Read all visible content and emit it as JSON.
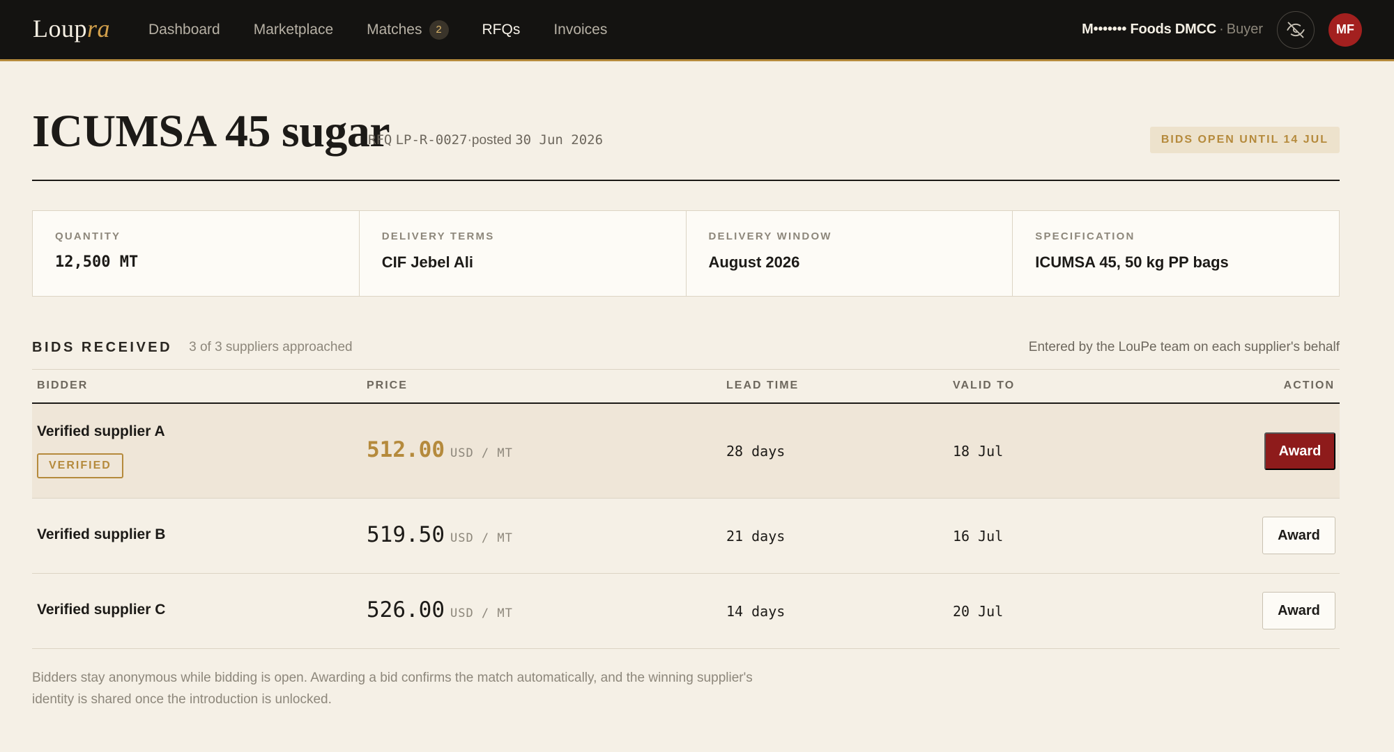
{
  "brand": {
    "name_prefix": "Loup",
    "name_accent": "ra"
  },
  "nav": {
    "links": [
      {
        "label": "Dashboard"
      },
      {
        "label": "Marketplace"
      },
      {
        "label": "Matches",
        "badge": "2"
      },
      {
        "label": "RFQs"
      },
      {
        "label": "Invoices"
      }
    ],
    "org_name": "M••••••• Foods DMCC",
    "separator": "·",
    "role": "Buyer",
    "avatar_initials": "MF"
  },
  "header": {
    "title": "ICUMSA 45 sugar",
    "rfq_prefix": "RFQ",
    "rfq_id": "LP-R-0027",
    "separator": "·",
    "posted_label": "posted",
    "posted_date": "30 Jun 2026",
    "status": "BIDS OPEN UNTIL 14 JUL"
  },
  "specs": [
    {
      "label": "QUANTITY",
      "value": "12,500 MT"
    },
    {
      "label": "DELIVERY TERMS",
      "value": "CIF Jebel Ali"
    },
    {
      "label": "DELIVERY WINDOW",
      "value": "August 2026"
    },
    {
      "label": "SPECIFICATION",
      "value": "ICUMSA 45, 50 kg PP bags"
    }
  ],
  "bids": {
    "title": "BIDS RECEIVED",
    "subtitle": "3 of 3 suppliers approached",
    "note": "Entered by the LouPe team on each supplier's behalf",
    "columns": [
      "BIDDER",
      "PRICE",
      "LEAD TIME",
      "VALID TO",
      "ACTION"
    ],
    "rows": [
      {
        "bidder": "Verified supplier A",
        "badge": "VERIFIED",
        "price": "512.00",
        "unit": "USD / MT",
        "lead": "28 days",
        "valid": "18 Jul",
        "action": "Award"
      },
      {
        "bidder": "Verified supplier B",
        "price": "519.50",
        "unit": "USD / MT",
        "lead": "21 days",
        "valid": "16 Jul",
        "action": "Award"
      },
      {
        "bidder": "Verified supplier C",
        "price": "526.00",
        "unit": "USD / MT",
        "lead": "14 days",
        "valid": "20 Jul",
        "action": "Award"
      }
    ],
    "footnote": "Bidders stay anonymous while bidding is open. Awarding a bid confirms the match automatically, and the winning supplier's identity is shared once the introduction is unlocked."
  },
  "colors": {
    "nav_bg": "#141311",
    "accent_gold": "#b58a3c",
    "award_red": "#8e1b1b",
    "page_bg": "#f5f0e6"
  }
}
